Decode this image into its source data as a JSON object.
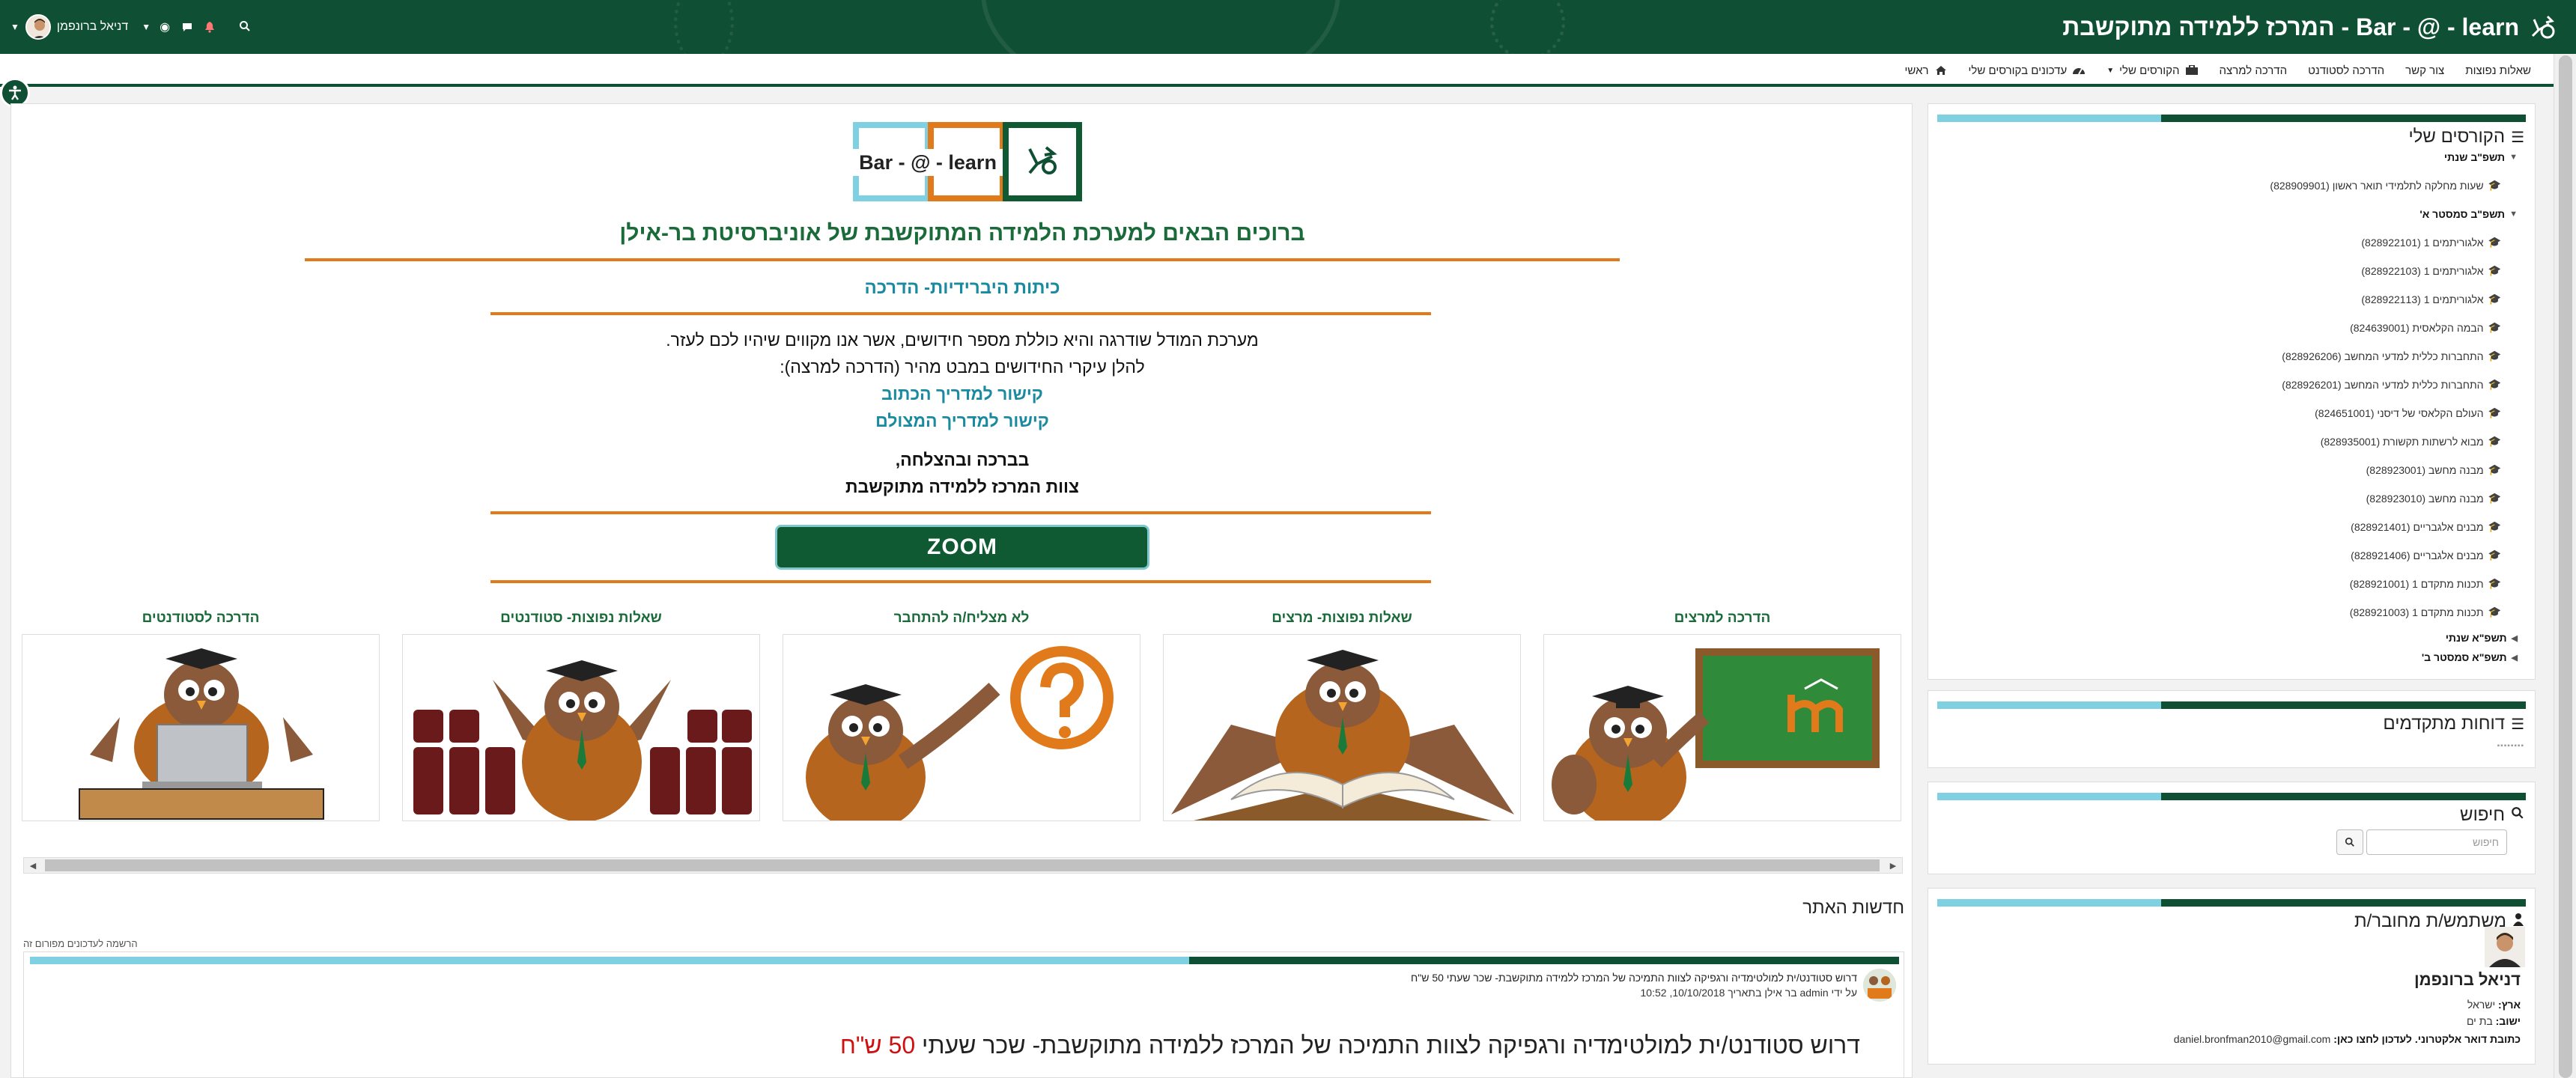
{
  "header": {
    "brand_text": "Bar - @ - learn - המרכז ללמידה מתוקשבת",
    "user_name": "דניאל ברונפמן",
    "colors": {
      "primary": "#0f4f33",
      "accent_orange": "#e07a1a",
      "accent_cyan": "#7fd0e0",
      "link": "#1a8aa0"
    }
  },
  "nav": {
    "items": [
      {
        "label": "ראשי",
        "icon": "home-icon"
      },
      {
        "label": "עדכונים בקורסים שלי",
        "icon": "dashboard-icon"
      },
      {
        "label": "הקורסים שלי",
        "icon": "briefcase-icon"
      },
      {
        "label": "הדרכה למרצה",
        "icon": ""
      },
      {
        "label": "הדרכה לסטודנט",
        "icon": ""
      },
      {
        "label": "צור קשר",
        "icon": ""
      },
      {
        "label": "שאלות נפוצות",
        "icon": ""
      }
    ]
  },
  "main": {
    "logo_text": "Bar - @ - learn",
    "welcome": "ברוכים הבאים למערכת הלמידה המתוקשבת של אוניברסיטת בר-אילן",
    "hybrid_title": "כיתות היברידיות- הדרכה",
    "intro_line1": "מערכת המודל שודרגה והיא כוללת מספר חידושים, אשר אנו מקווים שיהיו לכם לעזר.",
    "intro_line2": "להלן עיקרי החידושים במבט מהיר (הדרכה למרצה):",
    "link_written": "קישור למדריך הכתוב",
    "link_video": "קישור למדריך המצולם",
    "sign1": "בברכה ובהצלחה,",
    "sign2": "צוות המרכז ללמידה מתוקשבת",
    "zoom_label": "ZOOM",
    "cards": [
      {
        "title": "הדרכה למרצים",
        "image": "owl-teacher-board"
      },
      {
        "title": "שאלות נפוצות- מרצים",
        "image": "owl-book"
      },
      {
        "title": "לא מצליח/ה להתחבר",
        "image": "owl-question"
      },
      {
        "title": "שאלות נפוצות- סטודנטים",
        "image": "owl-lecture-hall"
      },
      {
        "title": "הדרכה לסטודנטים",
        "image": "owl-laptop"
      }
    ]
  },
  "news": {
    "title": "חדשות האתר",
    "subscription_note": "הרשמה לעדכונים מפורום זה",
    "post_title": "דרוש סטודנט/ית למולטימדיה ורגפיקה לצוות התמיכה של המרכז ללמידה מתוקשבת- שכר שעתי 50 ש\"ח",
    "post_meta": "על ידי admin בר אילן בתאריך 10/10/2018, 10:52",
    "post_heading": "דרוש סטודנט/ית  למולטימדיה ורגפיקה לצוות התמיכה של המרכז ללמידה מתוקשבת- שכר שעתי",
    "post_heading_pay": "50 ש\"ח"
  },
  "sidebar": {
    "courses": {
      "title": "הקורסים שלי",
      "rows": [
        {
          "label": "תשפ\"ב שנתי",
          "type": "cat-open"
        },
        {
          "label": "שעות מחלקה לתלמידי תואר ראשון (828909901)",
          "type": "course"
        },
        {
          "label": "תשפ\"ב סמסטר א'",
          "type": "cat-open"
        },
        {
          "label": "אלגוריתמים 1 (828922101)",
          "type": "course"
        },
        {
          "label": "אלגוריתמים 1 (828922103)",
          "type": "course"
        },
        {
          "label": "אלגוריתמים 1 (828922113)",
          "type": "course"
        },
        {
          "label": "הבמה הקלאסית (824639001)",
          "type": "course"
        },
        {
          "label": "התחברות כללית למדעי המחשב (828926206)",
          "type": "course"
        },
        {
          "label": "התחברות כללית למדעי המחשב (828926201)",
          "type": "course"
        },
        {
          "label": "העולם הקלאסי של דיסני (824651001)",
          "type": "course"
        },
        {
          "label": "מבוא לרשתות תקשורת (828935001)",
          "type": "course"
        },
        {
          "label": "מבנה מחשב (828923001)",
          "type": "course"
        },
        {
          "label": "מבנה מחשב (828923010)",
          "type": "course"
        },
        {
          "label": "מבנים אלגבריים (828921401)",
          "type": "course"
        },
        {
          "label": "מבנים אלגבריים (828921406)",
          "type": "course"
        },
        {
          "label": "תכנות מתקדם 1 (828921001)",
          "type": "course"
        },
        {
          "label": "תכנות מתקדם 1 (828921003)",
          "type": "course"
        },
        {
          "label": "תשפ\"א שנתי",
          "type": "cat-closed"
        },
        {
          "label": "תשפ\"א סמסטר ב'",
          "type": "cat-closed"
        }
      ]
    },
    "reports": {
      "title": "דוחות מתקדמים",
      "placeholder_dots": "▪▪▪▪▪▪▪▪"
    },
    "search": {
      "title": "חיפוש",
      "placeholder": "חיפוש"
    },
    "user": {
      "title": "משתמש/ת מחובר/ת",
      "name": "דניאל ברונפמן",
      "country_label": "ארץ:",
      "country": "ישראל",
      "city_label": "ישוב:",
      "city": "בת ים",
      "email_label": "כתובת דואר אלקטרוני. לעדכון לחצו כאן:",
      "email": "daniel.bronfman2010@gmail.com"
    }
  }
}
